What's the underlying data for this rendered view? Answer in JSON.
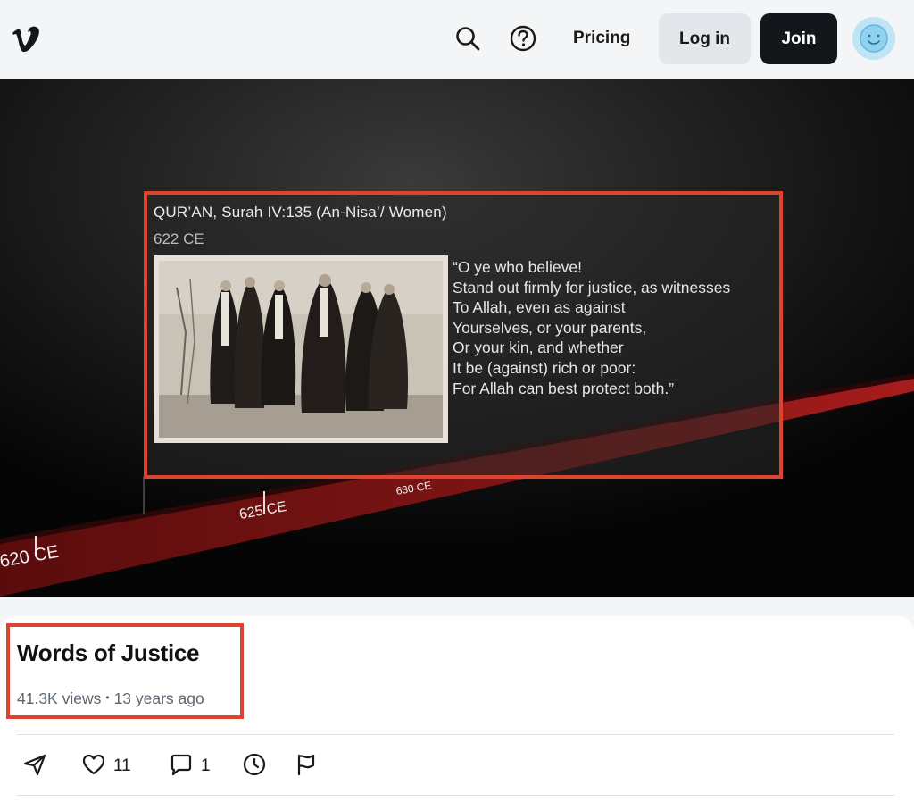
{
  "header": {
    "logo_icon": "vimeo-logo-icon",
    "search_icon": "search-icon",
    "help_icon": "help-circle-icon",
    "pricing_label": "Pricing",
    "login_label": "Log in",
    "join_label": "Join",
    "avatar_icon": "smiley-avatar-icon"
  },
  "video": {
    "card_title": "QUR’AN, Surah IV:135 (An-Nisa’/ Women)",
    "card_date": "622 CE",
    "quote_lines": [
      "“O ye who believe!",
      "Stand out firmly for justice, as witnesses",
      "To Allah, even as against",
      "Yourselves, or your parents,",
      "Or your kin, and whether",
      "It be (against) rich or poor:",
      "For Allah can best protect both.”"
    ],
    "timeline_labels": [
      "620 CE",
      "625 CE",
      "630 CE"
    ],
    "accent_color": "#d9452e",
    "timeline_color": "#6e1010"
  },
  "info": {
    "title": "Words of Justice",
    "views": "41.3K views",
    "age": "13 years ago",
    "actions": {
      "share_icon": "send-icon",
      "like_icon": "heart-icon",
      "like_count": "11",
      "comment_icon": "comment-icon",
      "comment_count": "1",
      "watch_later_icon": "clock-icon",
      "report_icon": "flag-icon"
    }
  }
}
